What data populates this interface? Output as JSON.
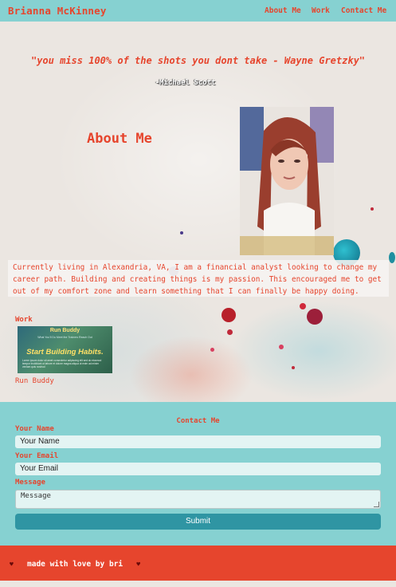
{
  "navbar": {
    "brand": "Brianna McKinney",
    "links": [
      "About Me",
      "Work",
      "Contact Me"
    ]
  },
  "hero": {
    "quote": "\"you miss 100% of the shots you dont take - Wayne Gretzky\"",
    "attribution": "-Michael Scott"
  },
  "about": {
    "title": "About Me",
    "photo_alt": "profile-photo",
    "text": "Currently living in Alexandria, VA, I am a financial analyst looking to change my career path. Building and creating things is my passion. This encouraged me to get out of my comfort zone and learn something that I can finally be happy doing."
  },
  "work": {
    "title": "Work",
    "project": {
      "thumb_title": "Run Buddy",
      "thumb_nav": "What You'll Do   Meet the Trainers   Reach Out",
      "thumb_headline": "Start Building Habits.",
      "thumb_body": "Lorem ipsum dolor sit amet consectetur adipiscing elit sed do eiusmod tempor incididunt ut labore et dolore magna aliqua ut enim ad minim veniam quis nostrud",
      "caption": "Run Buddy"
    }
  },
  "contact": {
    "title": "Contact Me",
    "name_label": "Your Name",
    "name_placeholder": "Your Name",
    "email_label": "Your Email",
    "email_placeholder": "Your Email",
    "message_label": "Message",
    "message_placeholder": "Message",
    "submit_label": "Submit"
  },
  "footer": {
    "heart": "♥",
    "text": "made with love by bri"
  },
  "colors": {
    "accent": "#e6452d",
    "teal": "#86d1d1",
    "button": "#2f95a3"
  }
}
